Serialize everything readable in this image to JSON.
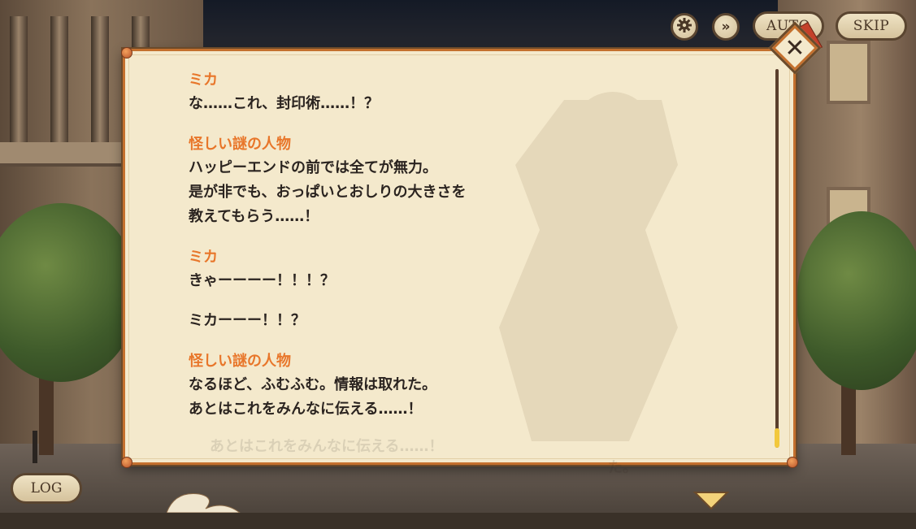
{
  "toolbar": {
    "settings_icon": "gear-icon",
    "fast_forward_icon": "double-chevron-right-icon",
    "auto_label": "AUTO",
    "skip_label": "SKIP"
  },
  "log": {
    "entries": [
      {
        "speaker": "ミカ",
        "lines": [
          "な……これ、封印術……！？"
        ]
      },
      {
        "speaker": "怪しい謎の人物",
        "lines": [
          "ハッピーエンドの前では全てが無力。",
          "是が非でも、おっぱいとおしりの大きさを",
          "教えてもらう……！"
        ]
      },
      {
        "speaker": "ミカ",
        "lines": [
          "きゃーーーー！！！？"
        ]
      },
      {
        "speaker": "",
        "lines": [
          "ミカーーー！！？"
        ]
      },
      {
        "speaker": "怪しい謎の人物",
        "lines": [
          "なるほど、ふむふむ。情報は取れた。",
          "あとはこれをみんなに伝える……！"
        ]
      }
    ],
    "background_text": [
      "た。",
      "あとはこれをみんなに伝える……！"
    ],
    "scroll_position": 1.0
  },
  "close_icon": "close-x-icon",
  "log_button_label": "LOG",
  "colors": {
    "speaker": "#e8762a",
    "text": "#2b2420",
    "panel": "#f4e9cc",
    "border": "#c4702e",
    "scroll_thumb": "#f2c83c"
  }
}
